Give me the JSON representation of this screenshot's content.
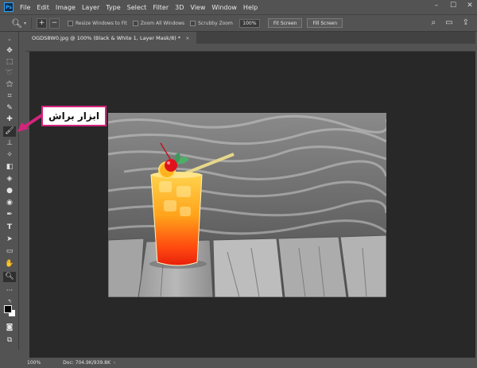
{
  "menubar": {
    "logo": "Ps",
    "items": [
      "File",
      "Edit",
      "Image",
      "Layer",
      "Type",
      "Select",
      "Filter",
      "3D",
      "View",
      "Window",
      "Help"
    ]
  },
  "options": {
    "resize_label": "Resize Windows to Fit",
    "zoom_all_label": "Zoom All Windows",
    "scrubby_label": "Scrubby Zoom",
    "zoom_value": "100%",
    "fit_screen": "Fit Screen",
    "fill_screen": "Fill Screen"
  },
  "tab": {
    "title": "OGDS8W0.jpg @ 100% (Black & White 1, Layer Mask/8) *",
    "close": "×"
  },
  "status": {
    "zoom": "100%",
    "doc": "Doc: 704.9K/939.8K"
  },
  "annotation": {
    "text": "ابزار براش",
    "color": "#d4247c"
  },
  "colors": {
    "foreground": "#000000",
    "background": "#ffffff"
  }
}
